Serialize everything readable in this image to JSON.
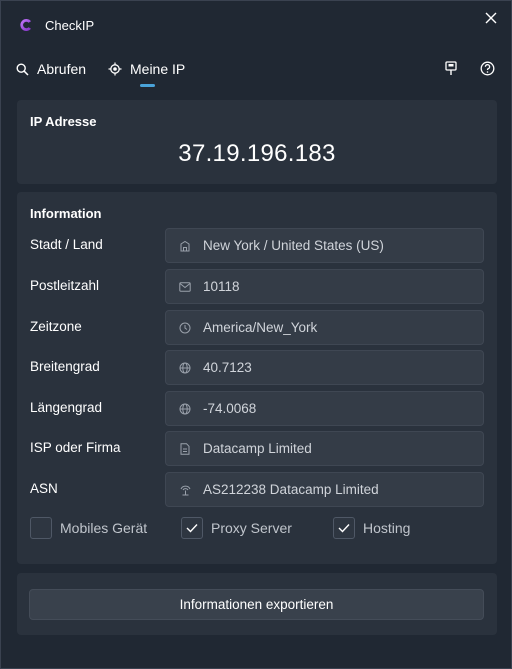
{
  "app": {
    "title": "CheckIP"
  },
  "nav": {
    "tabs": [
      {
        "label": "Abrufen",
        "icon": "search-icon",
        "active": false
      },
      {
        "label": "Meine IP",
        "icon": "location-target-icon",
        "active": true
      }
    ]
  },
  "ip_panel": {
    "heading": "IP Adresse",
    "ip": "37.19.196.183"
  },
  "info": {
    "heading": "Information",
    "rows": [
      {
        "label": "Stadt / Land",
        "value": "New York / United States (US)",
        "icon": "building-icon"
      },
      {
        "label": "Postleitzahl",
        "value": "10118",
        "icon": "mail-icon"
      },
      {
        "label": "Zeitzone",
        "value": "America/New_York",
        "icon": "clock-icon"
      },
      {
        "label": "Breitengrad",
        "value": "40.7123",
        "icon": "globe-icon"
      },
      {
        "label": "Längengrad",
        "value": "-74.0068",
        "icon": "globe-icon"
      },
      {
        "label": "ISP oder Firma",
        "value": "Datacamp Limited",
        "icon": "document-icon"
      },
      {
        "label": "ASN",
        "value": "AS212238 Datacamp Limited",
        "icon": "antenna-icon"
      }
    ],
    "checkboxes": [
      {
        "label": "Mobiles Gerät",
        "checked": false
      },
      {
        "label": "Proxy Server",
        "checked": true
      },
      {
        "label": "Hosting",
        "checked": true
      }
    ]
  },
  "export": {
    "button_label": "Informationen exportieren"
  },
  "colors": {
    "background": "#202833",
    "panel": "#2a323d",
    "accent": "#4aa3d9",
    "logo": "#a855f7"
  }
}
